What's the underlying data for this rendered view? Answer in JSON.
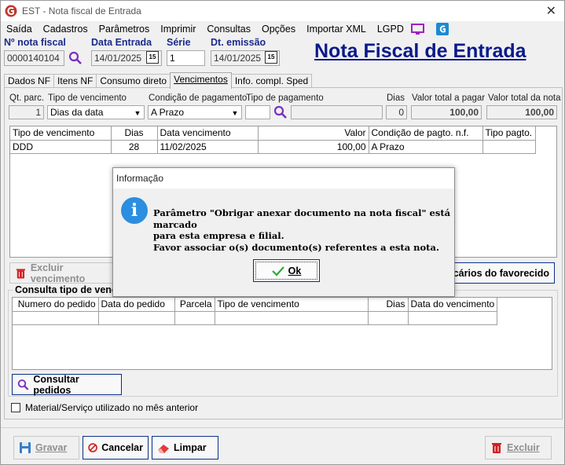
{
  "window": {
    "title": "EST - Nota fiscal de Entrada",
    "close_glyph": "✕"
  },
  "menu": [
    "Saída",
    "Cadastros",
    "Parâmetros",
    "Imprimir",
    "Consultas",
    "Opções",
    "Importar XML",
    "LGPD"
  ],
  "header": {
    "nota_fiscal_label": "Nº nota fiscal",
    "nota_fiscal_value": "0000140104",
    "data_entrada_label": "Data Entrada",
    "data_entrada_value": "14/01/2025",
    "serie_label": "Série",
    "serie_value": "1",
    "dt_emissao_label": "Dt. emissão",
    "dt_emissao_value": "14/01/2025",
    "calendar_glyph": "15",
    "page_title": "Nota Fiscal de Entrada"
  },
  "tabs": [
    {
      "label": "Dados NF",
      "active": false
    },
    {
      "label": "Itens NF",
      "active": false
    },
    {
      "label": "Consumo direto",
      "active": false
    },
    {
      "label": "Vencimentos",
      "active": true
    },
    {
      "label": "Info. compl. Sped",
      "active": false
    }
  ],
  "vencimentos_form": {
    "qt_parc_label": "Qt. parc.",
    "qt_parc_value": "1",
    "tipo_venc_label": "Tipo de vencimento",
    "tipo_venc_value": "Dias da data",
    "cond_pag_label": "Condição de pagamento",
    "cond_pag_value": "A Prazo",
    "tipo_pag_label": "Tipo de pagamento",
    "tipo_pag_value": "",
    "dias_label": "Dias",
    "dias_value": "0",
    "valor_total_pagar_label": "Valor total a pagar",
    "valor_total_pagar_value": "100,00",
    "valor_total_nota_label": "Valor total da nota",
    "valor_total_nota_value": "100,00"
  },
  "venc_grid": {
    "columns": [
      "Tipo de vencimento",
      "Dias",
      "Data vencimento",
      "Valor",
      "Condição de pagto. n.f.",
      "Tipo pagto."
    ],
    "rows": [
      [
        "DDD",
        "28",
        "11/02/2025",
        "100,00",
        "A Prazo",
        ""
      ]
    ]
  },
  "buttons": {
    "excluir_vencimento": "Excluir vencimento",
    "bancarios_favorecido": "ncários do favorecido",
    "consultar_pedidos": "Consultar pedidos",
    "gravar": "Gravar",
    "cancelar": "Cancelar",
    "limpar": "Limpar",
    "excluir": "Excluir"
  },
  "consulta": {
    "group_label": "Consulta tipo de venc",
    "columns": [
      "Numero do pedido",
      "Data do pedido",
      "Parcela",
      "Tipo de vencimento",
      "Dias",
      "Data do vencimento"
    ]
  },
  "checkbox_label": "Material/Serviço utilizado no mês anterior",
  "dialog": {
    "title": "Informação",
    "icon_glyph": "i",
    "message_lines": [
      "Parâmetro \"Obrigar anexar documento na nota fiscal\" está marcado",
      "para esta empresa e filial.",
      "Favor associar o(s) documento(s) referentes a esta nota."
    ],
    "ok_label": "Ok"
  },
  "colors": {
    "accent_blue": "#0a1a8a",
    "label_blue": "#1a2a8c",
    "info_blue": "#2b8ee0",
    "trash_red": "#d32020",
    "search_purple": "#7b2fbf"
  }
}
